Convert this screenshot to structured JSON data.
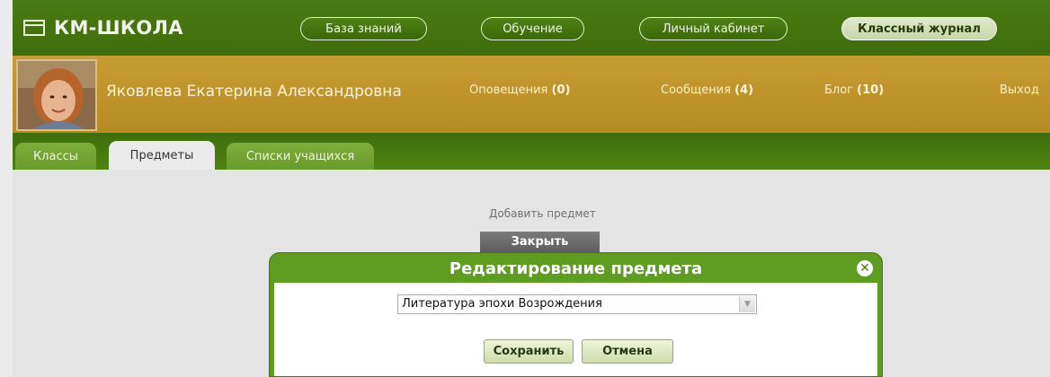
{
  "app": {
    "name": "КМ-ШКОЛА"
  },
  "nav": {
    "items": [
      {
        "label": "База знаний"
      },
      {
        "label": "Обучение"
      },
      {
        "label": "Личный кабинет"
      },
      {
        "label": "Классный журнал",
        "active": true
      }
    ]
  },
  "user": {
    "name": "Яковлева Екатерина Александровна",
    "links": [
      {
        "label": "Оповещения",
        "count": "(0)"
      },
      {
        "label": "Сообщения",
        "count": "(4)"
      },
      {
        "label": "Блог",
        "count": "(10)"
      },
      {
        "label": "Выход",
        "count": ""
      }
    ]
  },
  "tabs": [
    {
      "label": "Классы"
    },
    {
      "label": "Предметы",
      "active": true
    },
    {
      "label": "Списки учащихся"
    }
  ],
  "main": {
    "add_subject": "Добавить предмет",
    "close_label": "Закрыть"
  },
  "modal": {
    "title": "Редактирование предмета",
    "select_value": "Литература эпохи Возрождения",
    "save_label": "Сохранить",
    "cancel_label": "Отмена"
  },
  "colors": {
    "nav_green": "#4a7a12",
    "user_bar_gold": "#c79d33",
    "modal_green": "#5f9c22"
  },
  "icons": {
    "logo": "window-icon",
    "modal_close": "close-circle-icon",
    "select_arrow": "chevron-down-icon"
  }
}
